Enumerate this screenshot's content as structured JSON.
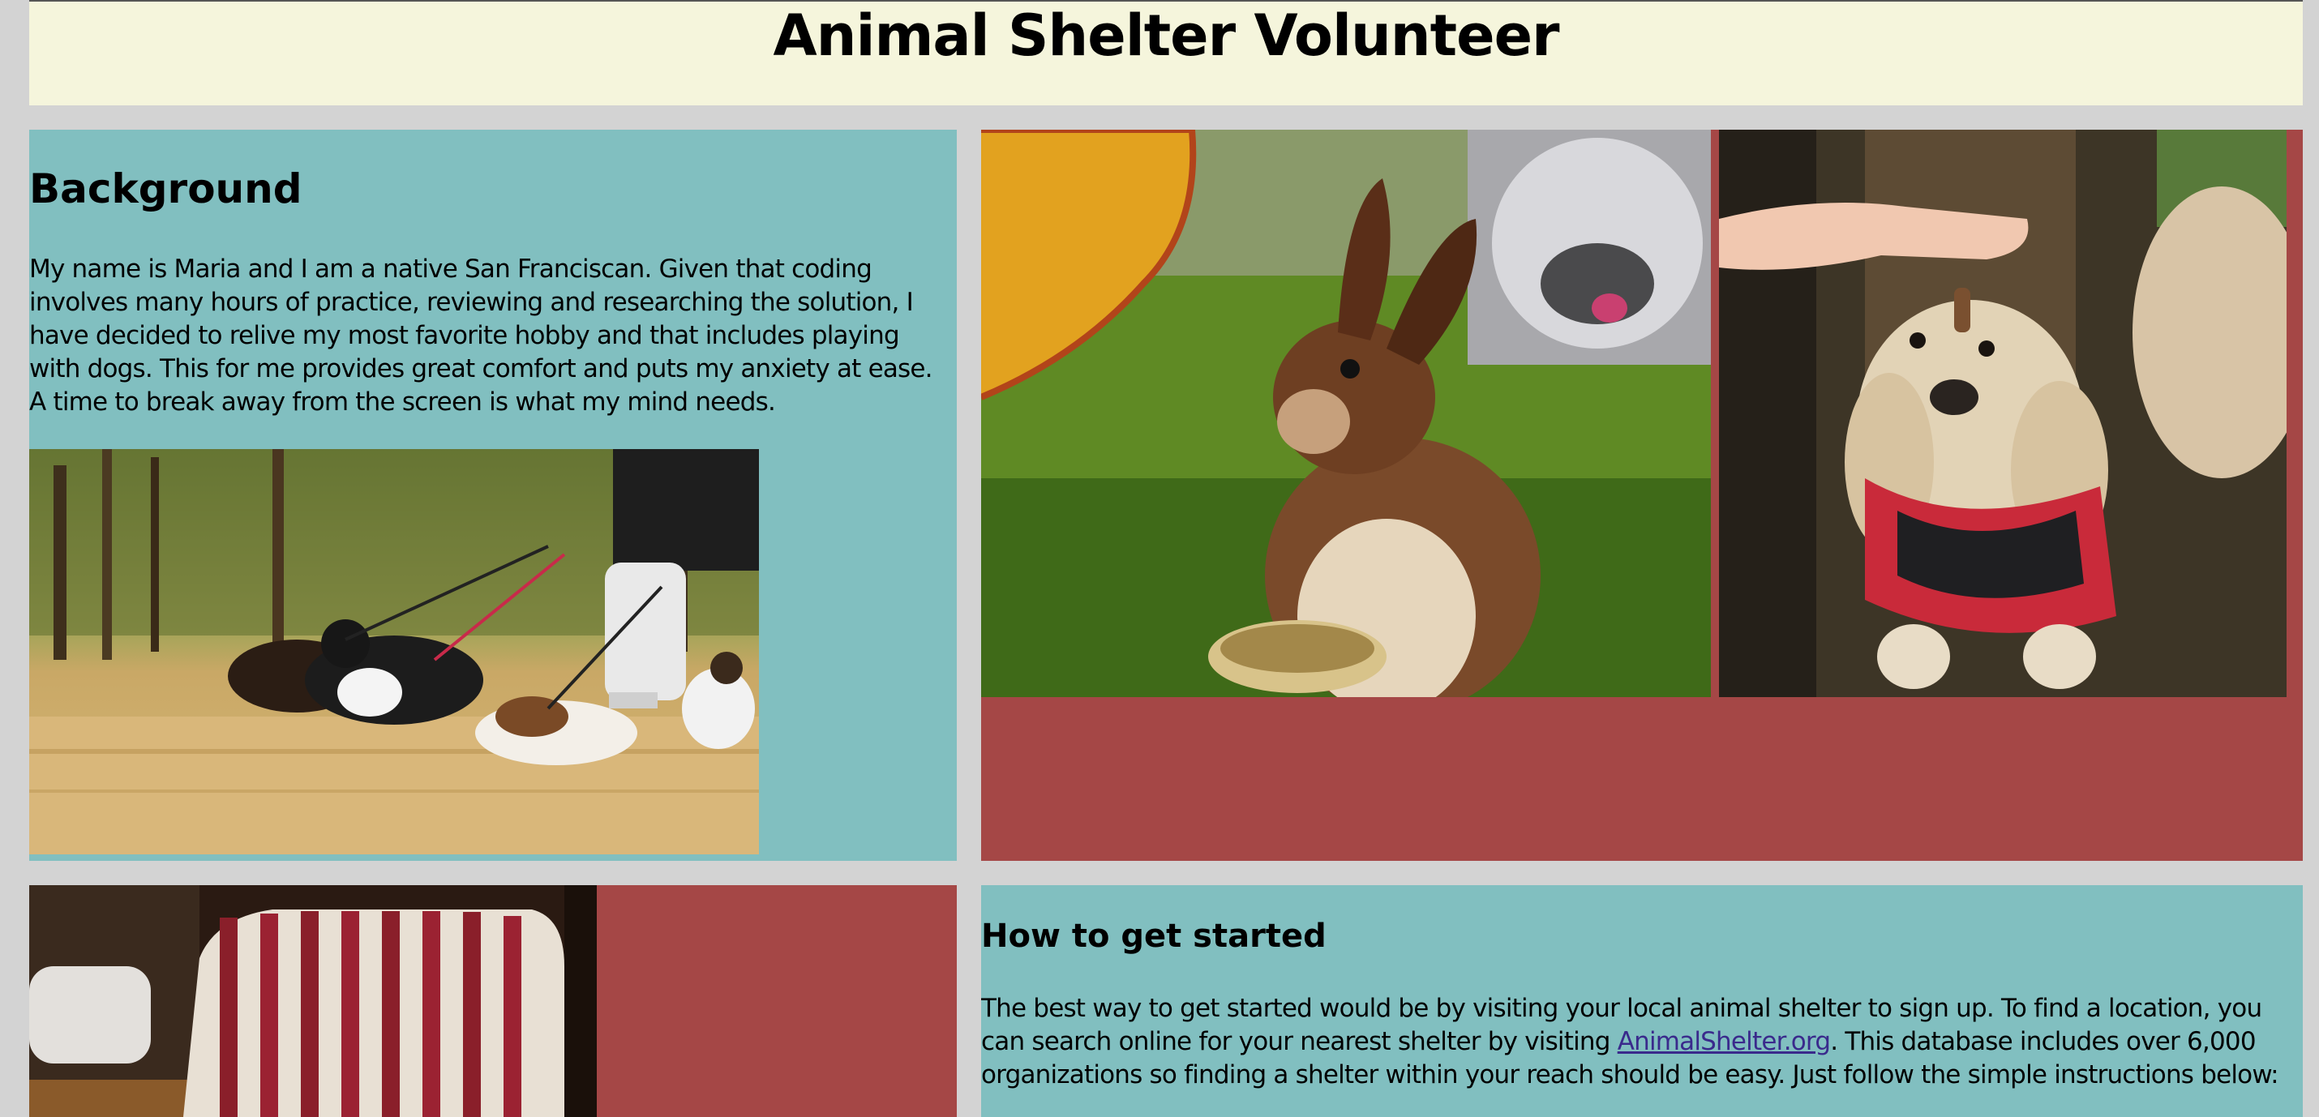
{
  "header": {
    "title": "Animal Shelter Volunteer"
  },
  "background": {
    "heading": "Background",
    "text": "My name is Maria and I am a native San Franciscan. Given that coding involves many hours of practice, reviewing and researching the solution, I have decided to relive my most favorite hobby and that includes playing with dogs. This for me provides great comfort and puts my anxiety at ease. A time to break away from the screen is what my mind needs."
  },
  "how_to": {
    "heading": "How to get started",
    "text_before": "The best way to get started would be by visiting your local animal shelter to sign up. To find a location, you can search online for your nearest shelter by visiting ",
    "link_text": "AnimalShelter.org",
    "text_after": ". This database includes over 6,000 organizations so finding a shelter within your reach should be easy. Just follow the simple instructions below:"
  },
  "colors": {
    "page_bg": "#d3d3d3",
    "header_bg": "#f5f5dc",
    "teal_panel": "#81bfc0",
    "red_panel": "#a54746"
  }
}
